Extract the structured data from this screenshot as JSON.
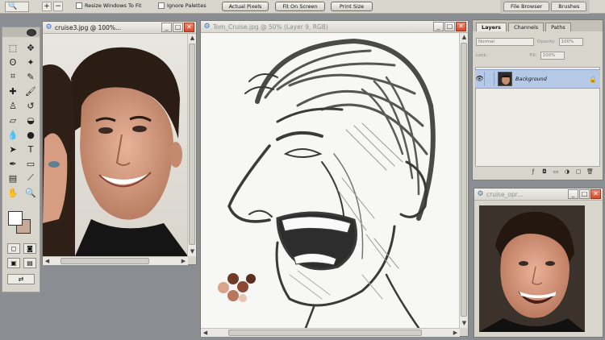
{
  "options_bar": {
    "tool_preset": "🔍",
    "resize_windows_label": "Resize Windows To Fit",
    "ignore_palettes_label": "Ignore Palettes",
    "actual_pixels_label": "Actual Pixels",
    "fit_on_screen_label": "Fit On Screen",
    "print_size_label": "Print Size"
  },
  "palette_well": {
    "file_browser_label": "File Browser",
    "brushes_label": "Brushes"
  },
  "windows": {
    "cruise3": {
      "title": "cruise3.jpg @ 100%..."
    },
    "tom_cruise": {
      "title": "Tom_Cruise.jpg @ 50% (Layer 9, RGB)"
    },
    "cruise_opr": {
      "title": "cruise_opr..."
    }
  },
  "layers_palette": {
    "tabs": [
      "Layers",
      "Channels",
      "Paths"
    ],
    "blend_mode": "Normal",
    "opacity_label": "Opacity:",
    "opacity_value": "100%",
    "lock_label": "Lock:",
    "fill_label": "Fill:",
    "fill_value": "100%",
    "layer_name": "Background"
  },
  "colors": {
    "foreground": "#ffffff",
    "background": "#c8a896",
    "close_button": "#d04a2d",
    "selected_layer": "#b5c8e6"
  }
}
